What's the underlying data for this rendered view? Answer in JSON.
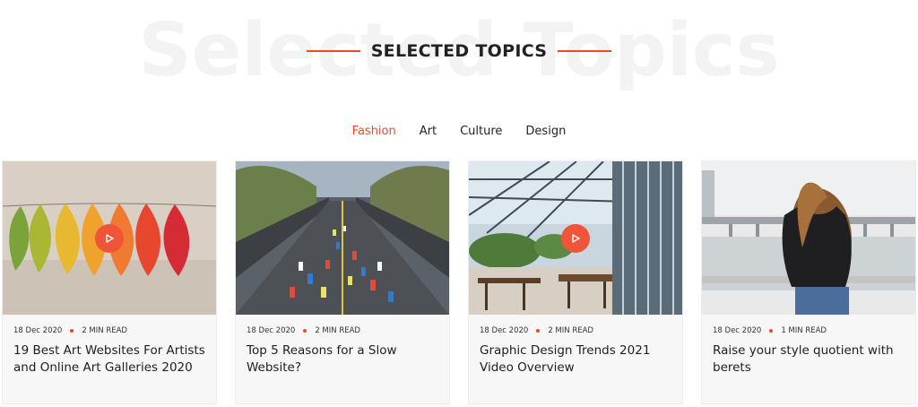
{
  "section": {
    "watermark": "Selected Topics",
    "title": "SELECTED TOPICS"
  },
  "tabs": [
    {
      "label": "Fashion",
      "active": true
    },
    {
      "label": "Art",
      "active": false
    },
    {
      "label": "Culture",
      "active": false
    },
    {
      "label": "Design",
      "active": false
    }
  ],
  "accent_color": "#ee4a2a",
  "cards": [
    {
      "date": "18 Dec 2020",
      "read_time": "2 MIN READ",
      "title": "19 Best Art Websites For Artists and Online Art Galleries 2020",
      "image": "autumn-leaves-on-string",
      "has_video": true
    },
    {
      "date": "18 Dec 2020",
      "read_time": "2 MIN READ",
      "title": "Top 5 Reasons for a Slow Website?",
      "image": "marathon-runners-on-road",
      "has_video": false
    },
    {
      "date": "18 Dec 2020",
      "read_time": "2 MIN READ",
      "title": "Graphic Design Trends 2021 Video Overview",
      "image": "glass-roof-cafe-atrium",
      "has_video": true
    },
    {
      "date": "18 Dec 2020",
      "read_time": "1 MIN READ",
      "title": "Raise your style quotient with berets",
      "image": "woman-by-river-bridge",
      "has_video": false
    }
  ]
}
